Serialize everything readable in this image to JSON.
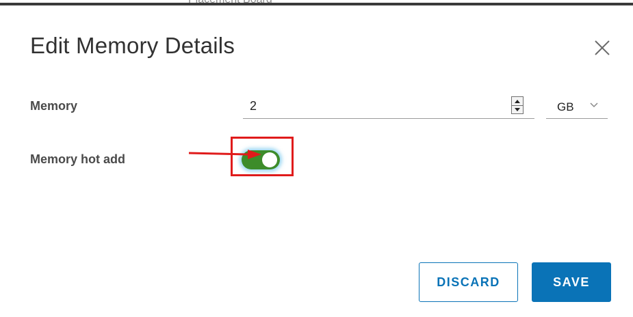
{
  "window": {
    "background_title": "Placement Board"
  },
  "dialog": {
    "title": "Edit Memory Details",
    "close_icon": "close-icon"
  },
  "memory": {
    "label": "Memory",
    "value": "2",
    "unit": "GB",
    "unit_options_visible": [
      "GB"
    ]
  },
  "hot_add": {
    "label": "Memory hot add",
    "enabled": true
  },
  "actions": {
    "discard_label": "DISCARD",
    "save_label": "SAVE"
  },
  "colors": {
    "accent": "#0a73b7",
    "toggle_on": "#3d8c2a",
    "annotation": "#e01b1b"
  }
}
